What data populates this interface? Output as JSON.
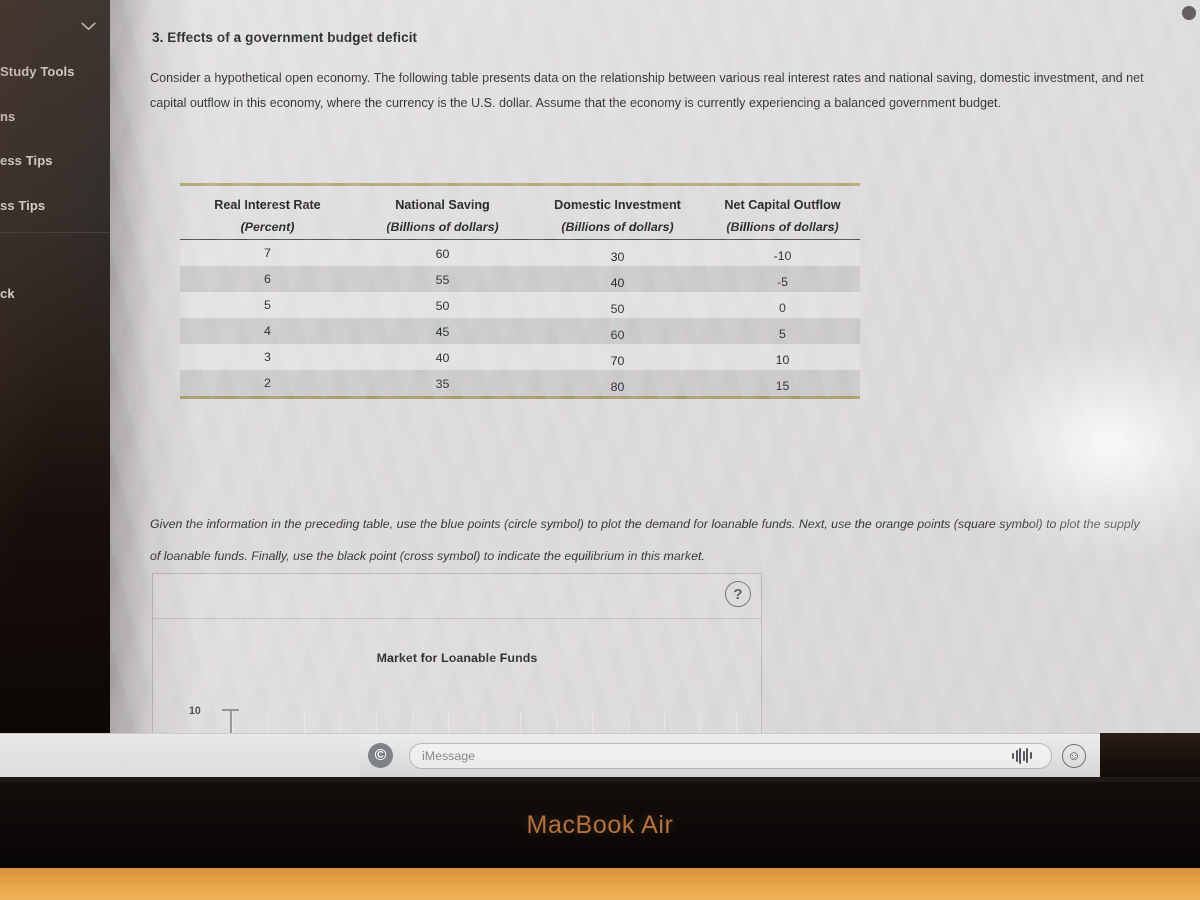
{
  "device": {
    "brand_label": "MacBook Air"
  },
  "sidebar": {
    "chevron_icon": "chevron-down-icon",
    "items": [
      {
        "label": "Study Tools"
      },
      {
        "label": "ns"
      },
      {
        "label": "ess Tips"
      },
      {
        "label": "ss Tips"
      },
      {
        "label": "ck"
      }
    ]
  },
  "question": {
    "heading": "3. Effects of a government budget deficit",
    "intro": "Consider a hypothetical open economy. The following table presents data on the relationship between various real interest rates and national saving, domestic investment, and net capital outflow in this economy, where the currency is the U.S. dollar. Assume that the economy is currently experiencing a balanced government budget.",
    "instruction": "Given the information in the preceding table, use the blue points (circle symbol) to plot the demand for loanable funds. Next, use the orange points (square symbol) to plot the supply of loanable funds. Finally, use the black point (cross symbol) to indicate the equilibrium in this market."
  },
  "table": {
    "columns": [
      {
        "title": "Real Interest Rate",
        "unit": "(Percent)"
      },
      {
        "title": "National Saving",
        "unit": "(Billions of dollars)"
      },
      {
        "title": "Domestic Investment",
        "unit": "(Billions of dollars)"
      },
      {
        "title": "Net Capital Outflow",
        "unit": "(Billions of dollars)"
      }
    ],
    "rows": [
      {
        "rate": "7",
        "saving": "60",
        "investment": "30",
        "nco": "-10"
      },
      {
        "rate": "6",
        "saving": "55",
        "investment": "40",
        "nco": "-5"
      },
      {
        "rate": "5",
        "saving": "50",
        "investment": "50",
        "nco": "0"
      },
      {
        "rate": "4",
        "saving": "45",
        "investment": "60",
        "nco": "5"
      },
      {
        "rate": "3",
        "saving": "40",
        "investment": "70",
        "nco": "10"
      },
      {
        "rate": "2",
        "saving": "35",
        "investment": "80",
        "nco": "15"
      }
    ]
  },
  "graph": {
    "title": "Market for Loanable Funds",
    "help_label": "?",
    "y_tick_label": "10",
    "point_tool_name": "blue-circle-point"
  },
  "chart_data": {
    "type": "table",
    "title": "Real interest rate vs. national saving, domestic investment and net capital outflow",
    "categories": [
      "7",
      "6",
      "5",
      "4",
      "3",
      "2"
    ],
    "xlabel": "Real Interest Rate (Percent)",
    "ylabel": "Billions of dollars",
    "series": [
      {
        "name": "National Saving (Billions of dollars)",
        "values": [
          60,
          55,
          50,
          45,
          40,
          35
        ]
      },
      {
        "name": "Domestic Investment (Billions of dollars)",
        "values": [
          30,
          40,
          50,
          60,
          70,
          80
        ]
      },
      {
        "name": "Net Capital Outflow (Billions of dollars)",
        "values": [
          -10,
          -5,
          0,
          5,
          10,
          15
        ]
      }
    ],
    "grid": false,
    "legend_position": "none"
  },
  "imessage": {
    "appstore_icon": "app-store-icon",
    "placeholder": "iMessage",
    "wave_icon": "audio-waveform-icon",
    "emoji_icon": "emoji-smiley-icon"
  }
}
